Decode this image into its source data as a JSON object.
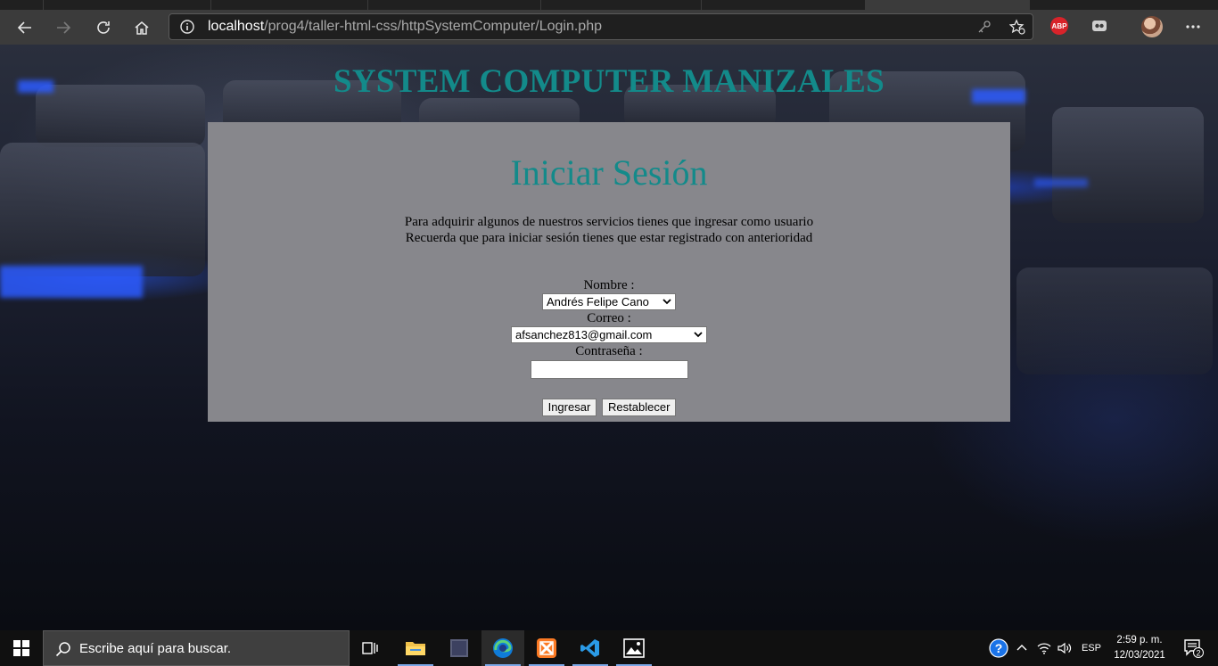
{
  "browser": {
    "url_host": "localhost",
    "url_path": "/prog4/taller-html-css/httpSystemComputer/Login.php",
    "abp_label": "ABP"
  },
  "page": {
    "site_title": "SYSTEM COMPUTER MANIZALES",
    "panel": {
      "heading": "Iniciar Sesión",
      "intro_line1": "Para adquirir algunos de nuestros servicios tienes que ingresar como usuario",
      "intro_line2": "Recuerda que para iniciar sesión tienes que estar registrado con anterioridad"
    },
    "form": {
      "name_label": "Nombre :",
      "name_value": "Andrés Felipe Cano",
      "email_label": "Correo :",
      "email_value": "afsanchez813@gmail.com",
      "password_label": "Contraseña :",
      "password_value": "",
      "submit_label": "Ingresar",
      "reset_label": "Restablecer"
    },
    "colors": {
      "title": "#138a8a",
      "panel": "#87878c"
    }
  },
  "taskbar": {
    "search_placeholder": "Escribe aquí para buscar.",
    "apps": [
      "task-view",
      "file-explorer",
      "photos-app",
      "edge",
      "xampp",
      "vscode",
      "photos"
    ],
    "tray": {
      "language": "ESP",
      "time": "2:59 p. m.",
      "date": "12/03/2021",
      "notifications": "2"
    }
  }
}
